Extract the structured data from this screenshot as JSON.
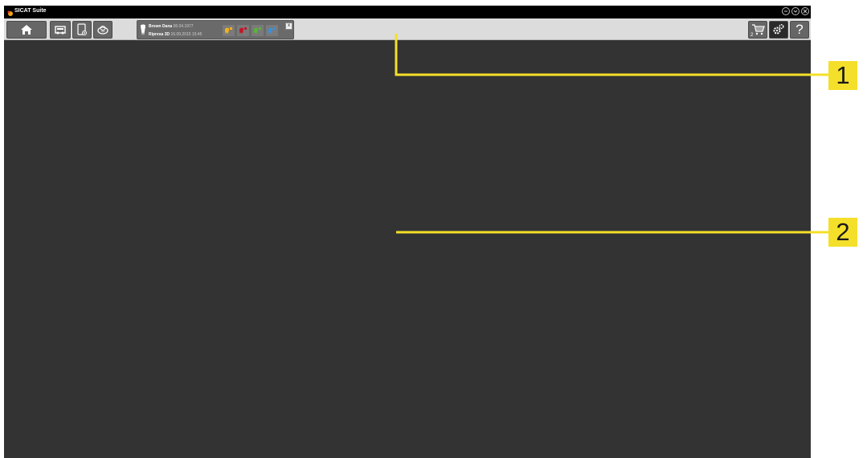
{
  "app": {
    "title": "SICAT Suite",
    "accent": "#f4df2a",
    "background": "#333333"
  },
  "window_controls": {
    "minimize_icon": "circle-minus-icon",
    "restore_icon": "circle-chevron-down-icon",
    "close_icon": "circle-x-icon"
  },
  "toolbar": {
    "home_icon": "home-icon",
    "patient_records_icon": "patient-records-icon",
    "new_record_icon": "new-record-icon",
    "volume_icon": "3d-volume-icon",
    "cart_icon": "shopping-cart-icon",
    "cart_count": "2",
    "settings_icon": "gears-icon",
    "help_label": "?"
  },
  "patient": {
    "name": "Brown Dana",
    "birthdate": "06.04.1977",
    "study": "Ripresa 3D",
    "study_datetime": "16.09.2015 15:45",
    "close_label": "x",
    "workflow_colors": [
      "#f2b21c",
      "#c0172a",
      "#5cb33a",
      "#3d8fd9"
    ]
  },
  "callouts": [
    {
      "label": "1"
    },
    {
      "label": "2"
    }
  ]
}
